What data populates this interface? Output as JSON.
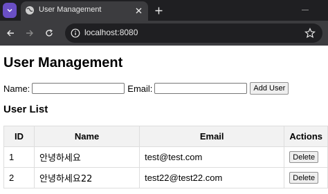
{
  "browser": {
    "tab_title": "User Management",
    "url": "localhost:8080",
    "accent_color": "#6a4fc4"
  },
  "icons": [
    "chevron-down-icon",
    "globe-icon",
    "close-icon",
    "plus-icon",
    "back-icon",
    "forward-icon",
    "reload-icon",
    "info-icon",
    "star-icon"
  ],
  "page": {
    "title": "User Management",
    "form": {
      "name_label": "Name:",
      "name_value": "",
      "email_label": "Email:",
      "email_value": "",
      "add_button": "Add User"
    },
    "list_title": "User List",
    "table": {
      "headers": [
        "ID",
        "Name",
        "Email",
        "Actions"
      ],
      "rows": [
        {
          "id": "1",
          "name": "안녕하세요",
          "email": "test@test.com",
          "action": "Delete"
        },
        {
          "id": "2",
          "name": "안녕하세요22",
          "email": "test22@test22.com",
          "action": "Delete"
        }
      ]
    }
  }
}
